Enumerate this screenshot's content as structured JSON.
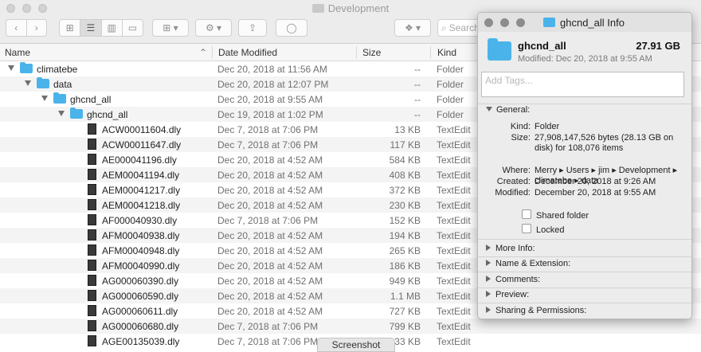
{
  "window": {
    "title": "Development"
  },
  "toolbar": {
    "search_placeholder": "Search"
  },
  "columns": {
    "name": "Name",
    "date": "Date Modified",
    "size": "Size",
    "kind": "Kind"
  },
  "rows": [
    {
      "name": "climatebe",
      "date": "Dec 20, 2018 at 11:56 AM",
      "size": "--",
      "kind": "Folder"
    },
    {
      "name": "data",
      "date": "Dec 20, 2018 at 12:07 PM",
      "size": "--",
      "kind": "Folder"
    },
    {
      "name": "ghcnd_all",
      "date": "Dec 20, 2018 at 9:55 AM",
      "size": "--",
      "kind": "Folder"
    },
    {
      "name": "ghcnd_all",
      "date": "Dec 19, 2018 at 1:02 PM",
      "size": "--",
      "kind": "Folder"
    },
    {
      "name": "ACW00011604.dly",
      "date": "Dec 7, 2018 at 7:06 PM",
      "size": "13 KB",
      "kind": "TextEdit"
    },
    {
      "name": "ACW00011647.dly",
      "date": "Dec 7, 2018 at 7:06 PM",
      "size": "117 KB",
      "kind": "TextEdit"
    },
    {
      "name": "AE000041196.dly",
      "date": "Dec 20, 2018 at 4:52 AM",
      "size": "584 KB",
      "kind": "TextEdit"
    },
    {
      "name": "AEM00041194.dly",
      "date": "Dec 20, 2018 at 4:52 AM",
      "size": "408 KB",
      "kind": "TextEdit"
    },
    {
      "name": "AEM00041217.dly",
      "date": "Dec 20, 2018 at 4:52 AM",
      "size": "372 KB",
      "kind": "TextEdit"
    },
    {
      "name": "AEM00041218.dly",
      "date": "Dec 20, 2018 at 4:52 AM",
      "size": "230 KB",
      "kind": "TextEdit"
    },
    {
      "name": "AF000040930.dly",
      "date": "Dec 7, 2018 at 7:06 PM",
      "size": "152 KB",
      "kind": "TextEdit"
    },
    {
      "name": "AFM00040938.dly",
      "date": "Dec 20, 2018 at 4:52 AM",
      "size": "194 KB",
      "kind": "TextEdit"
    },
    {
      "name": "AFM00040948.dly",
      "date": "Dec 20, 2018 at 4:52 AM",
      "size": "265 KB",
      "kind": "TextEdit"
    },
    {
      "name": "AFM00040990.dly",
      "date": "Dec 20, 2018 at 4:52 AM",
      "size": "186 KB",
      "kind": "TextEdit"
    },
    {
      "name": "AG000060390.dly",
      "date": "Dec 20, 2018 at 4:52 AM",
      "size": "949 KB",
      "kind": "TextEdit"
    },
    {
      "name": "AG000060590.dly",
      "date": "Dec 20, 2018 at 4:52 AM",
      "size": "1.1 MB",
      "kind": "TextEdit"
    },
    {
      "name": "AG000060611.dly",
      "date": "Dec 20, 2018 at 4:52 AM",
      "size": "727 KB",
      "kind": "TextEdit"
    },
    {
      "name": "AG000060680.dly",
      "date": "Dec 7, 2018 at 7:06 PM",
      "size": "799 KB",
      "kind": "TextEdit"
    },
    {
      "name": "AGE00135039.dly",
      "date": "Dec 7, 2018 at 7:06 PM",
      "size": "33 KB",
      "kind": "TextEdit"
    }
  ],
  "screenshot_pill": "Screenshot",
  "info": {
    "title": "ghcnd_all Info",
    "name": "ghcnd_all",
    "size": "27.91 GB",
    "modified": "Modified: Dec 20, 2018 at 9:55 AM",
    "tags_placeholder": "Add Tags...",
    "general_label": "General:",
    "kind_label": "Kind:",
    "kind_value": "Folder",
    "size_label": "Size:",
    "size_value": "27,908,147,526 bytes (28.13 GB on disk) for 108,076 items",
    "where_label": "Where:",
    "where_value": "Merry ▸ Users ▸ jim ▸ Development ▸ climatebe ▸ data",
    "created_label": "Created:",
    "created_value": "December 20, 2018 at 9:26 AM",
    "modified_label": "Modified:",
    "modified_value": "December 20, 2018 at 9:55 AM",
    "shared_folder": "Shared folder",
    "locked": "Locked",
    "sections": [
      "More Info:",
      "Name & Extension:",
      "Comments:",
      "Preview:",
      "Sharing & Permissions:"
    ]
  }
}
